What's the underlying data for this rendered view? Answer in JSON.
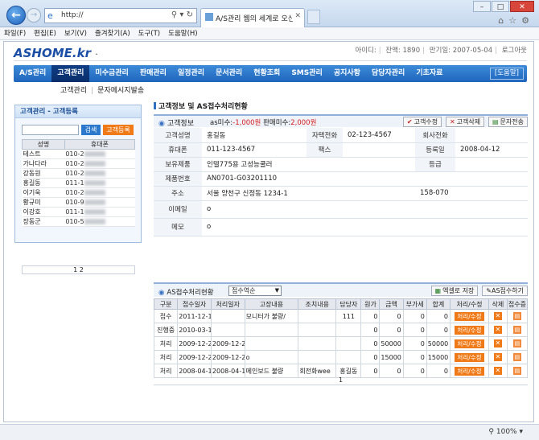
{
  "browser": {
    "address": "http://",
    "tab_title": "A/S관리 웹의 세계로 오신 ...",
    "zoom": "100%"
  },
  "menubar": [
    "파일(F)",
    "편집(E)",
    "보기(V)",
    "즐겨찾기(A)",
    "도구(T)",
    "도움말(H)"
  ],
  "header": {
    "logo": "ASHOME.kr",
    "logo_tail": "·",
    "user_id": "아이디:",
    "balance": "잔액: 1890",
    "expiry": "만기일: 2007-05-04",
    "logout": "로그아웃"
  },
  "mainnav": {
    "items": [
      "A/S관리",
      "고객관리",
      "미수금관리",
      "판매관리",
      "일정관리",
      "문서관리",
      "현황조회",
      "SMS관리",
      "공지사항",
      "담당자관리",
      "기초자료"
    ],
    "help": "[도움말]"
  },
  "subnav": {
    "items": [
      "고객관리",
      "문자메시지발송"
    ]
  },
  "leftpanel": {
    "title": "고객관리 - 고객등록",
    "search_button": "검색",
    "register_button": "고객등록",
    "columns": [
      "성명",
      "휴대폰"
    ],
    "rows": [
      {
        "name": "테스트",
        "phone": "010-2"
      },
      {
        "name": "가나다라",
        "phone": "010-2"
      },
      {
        "name": "강동원",
        "phone": "010-2"
      },
      {
        "name": "홍길동",
        "phone": "011-1"
      },
      {
        "name": "이기욱",
        "phone": "010-2"
      },
      {
        "name": "황규미",
        "phone": "010-9"
      },
      {
        "name": "이강호",
        "phone": "011-1"
      },
      {
        "name": "장동군",
        "phone": "010-5"
      }
    ],
    "pager": "1 2"
  },
  "content": {
    "section_title": "고객정보 및 AS접수처리현황",
    "info": {
      "label": "고객정보",
      "as_arrears_label": "as미수:",
      "as_arrears_value": "-1,000원",
      "sales_arrears_label": "판매미수:",
      "sales_arrears_value": "2,000원",
      "buttons": [
        "고객수정",
        "고객삭제",
        "문자전송"
      ]
    },
    "fields": {
      "name_label": "고객성명",
      "name": "홍길동",
      "home_phone_label": "자택전화",
      "home_phone": "02-123-4567",
      "office_phone_label": "회사전화",
      "office_phone": "",
      "mobile_label": "휴대폰",
      "mobile": "011-123-4567",
      "fax_label": "팩스",
      "fax": "",
      "reg_date_label": "등록일",
      "reg_date": "2008-04-12",
      "product_label": "보유제품",
      "product": "인텔775용 고성능쿨러",
      "grade_label": "등급",
      "grade": "",
      "serial_label": "제품번호",
      "serial": "AN0701-G03201110",
      "address_label": "주소",
      "address": "서울 양천구 신정동 1234-1",
      "zipcode": "158-070",
      "email_label": "이메일",
      "email": "o",
      "memo_label": "메모",
      "memo": "o"
    },
    "as": {
      "label": "AS접수처리현황",
      "sort_select": "접수역순",
      "buttons": [
        "엑셀로 저장",
        "AS접수하기"
      ],
      "columns": [
        "구분",
        "접수일자",
        "처리일자",
        "고장내용",
        "조치내용",
        "담당자",
        "원가",
        "금액",
        "부가세",
        "합계",
        "처리/수정",
        "삭제",
        "접수증"
      ],
      "rows": [
        {
          "type": "접수",
          "recv": "2011-12-19",
          "done": "",
          "issue": "모니터가 불량/",
          "action": "",
          "staff": "111",
          "cost": "0",
          "amount": "0",
          "vat": "0",
          "total": "0"
        },
        {
          "type": "진행중",
          "recv": "2010-03-16",
          "done": "",
          "issue": "",
          "action": "",
          "staff": "",
          "cost": "0",
          "amount": "0",
          "vat": "0",
          "total": "0"
        },
        {
          "type": "처리",
          "recv": "2009-12-29",
          "done": "2009-12-29",
          "issue": "",
          "action": "",
          "staff": "",
          "cost": "0",
          "amount": "50000",
          "vat": "0",
          "total": "50000"
        },
        {
          "type": "처리",
          "recv": "2009-12-29",
          "done": "2009-12-29",
          "issue": "o",
          "action": "",
          "staff": "",
          "cost": "0",
          "amount": "15000",
          "vat": "0",
          "total": "15000"
        },
        {
          "type": "처리",
          "recv": "2008-04-12",
          "done": "2008-04-12",
          "issue": "메인보드 불량",
          "action": "회전화wee",
          "staff": "홍길동",
          "cost": "0",
          "amount": "0",
          "vat": "0",
          "total": "0"
        }
      ],
      "row_button": "처리/수정",
      "pager": "1"
    }
  }
}
